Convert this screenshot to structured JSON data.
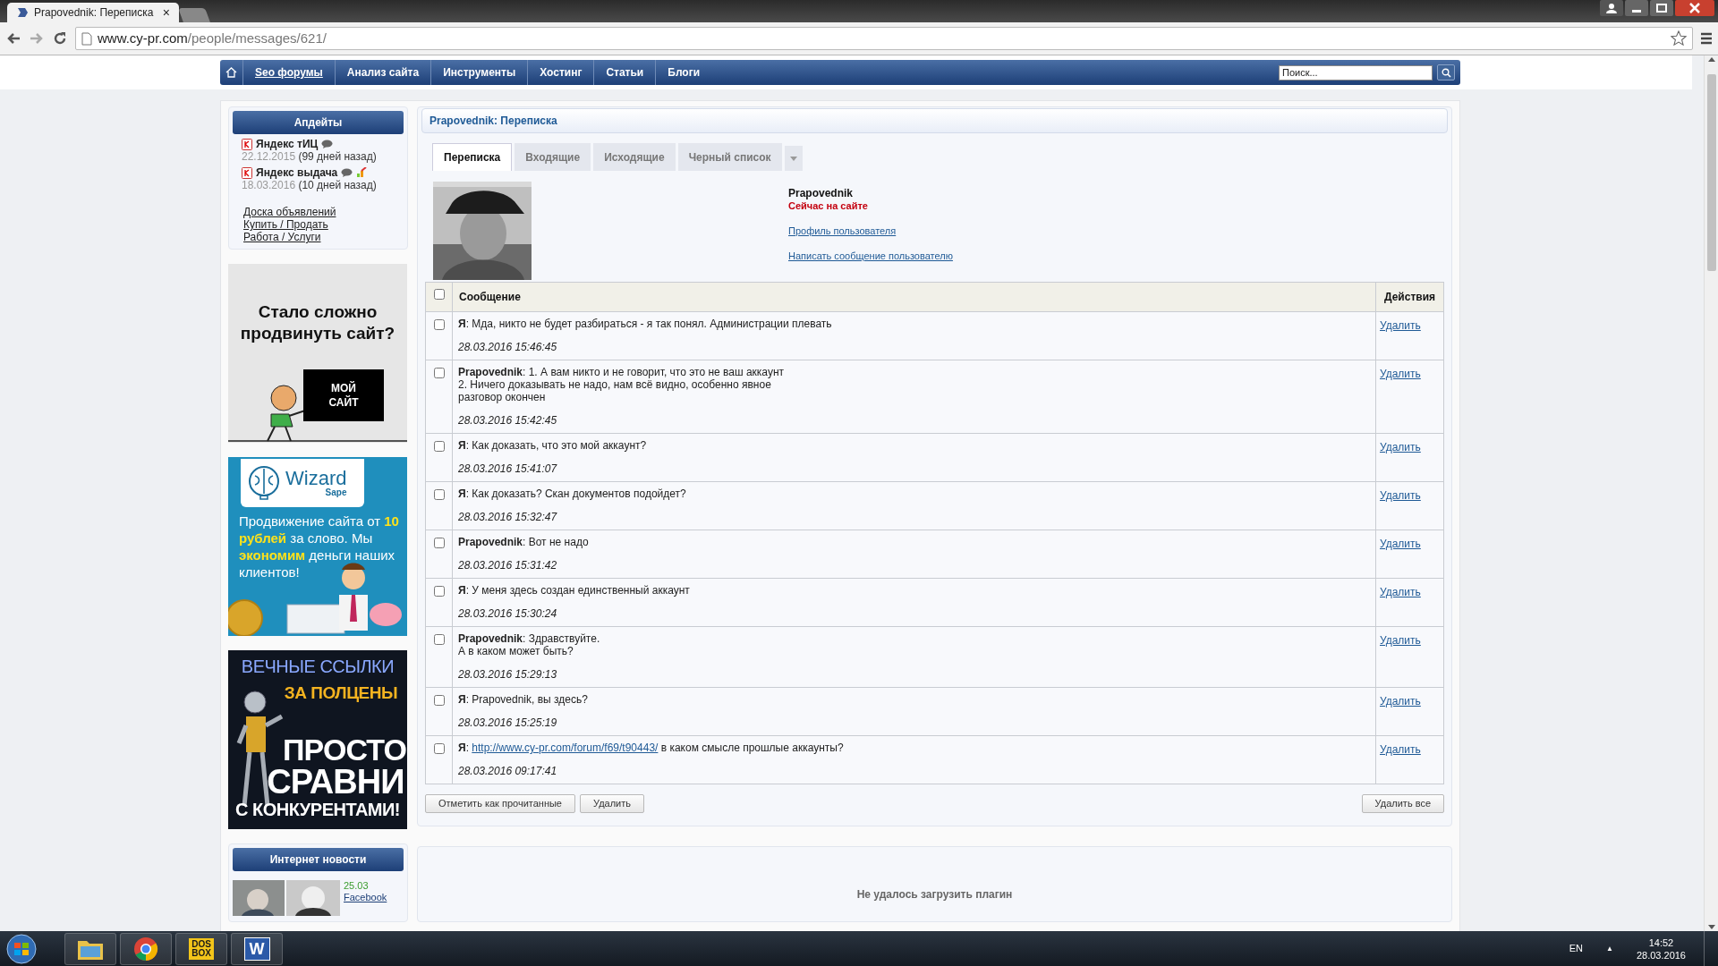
{
  "browser": {
    "tab_title": "Prapovednik: Переписка",
    "close": "×",
    "url_host": "www.cy-pr.com",
    "url_path": "/people/messages/621/"
  },
  "nav": {
    "items": [
      {
        "label": "Seo форумы",
        "selected": true
      },
      {
        "label": "Анализ сайта",
        "selected": false
      },
      {
        "label": "Инструменты",
        "selected": false
      },
      {
        "label": "Хостинг",
        "selected": false
      },
      {
        "label": "Статьи",
        "selected": false
      },
      {
        "label": "Блоги",
        "selected": false
      }
    ],
    "search": {
      "placeholder": "Поиск..."
    }
  },
  "sidebar": {
    "updates_title": "Апдейты",
    "updates": [
      {
        "name": "Яндекс тИЦ",
        "date": "22.12.2015",
        "ago": "(99 дней назад)",
        "rising": false
      },
      {
        "name": "Яндекс выдача",
        "date": "18.03.2016",
        "ago": "(10 дней назад)",
        "rising": true
      }
    ],
    "links": [
      "Доска объявлений",
      "Купить / Продать",
      "Работа / Услуги"
    ],
    "ads": [
      {
        "kind": "comic",
        "headline": "Стало сложно продвинуть сайт?",
        "sign": "МОЙ\nСАЙТ"
      },
      {
        "kind": "wizard",
        "brand": "Wizard",
        "sub": "Sape",
        "text": "Продвижение сайта от **10 рублей** за слово. Мы **экономим** деньги наших клиентов!"
      },
      {
        "kind": "robot",
        "lines": [
          "ВЕЧНЫЕ ССЫЛКИ",
          "ЗА ПОЛЦЕНЫ",
          "ПРОСТО",
          "СРАВНИ",
          "С КОНКУРЕНТАМИ!"
        ]
      }
    ],
    "news_title": "Интернет новости",
    "news": {
      "date": "25.03",
      "link": "Facebook"
    }
  },
  "main": {
    "title": "Prapovednik: Переписка",
    "tabs": [
      {
        "label": "Переписка",
        "selected": true
      },
      {
        "label": "Входящие",
        "selected": false
      },
      {
        "label": "Исходящие",
        "selected": false
      },
      {
        "label": "Черный список",
        "selected": false
      }
    ],
    "user": {
      "name": "Prapovednik",
      "status": "Сейчас на сайте",
      "links": [
        "Профиль пользователя",
        "Написать сообщение пользователю"
      ]
    },
    "table": {
      "columns": [
        "Сообщение",
        "Действия"
      ],
      "all_checked": false,
      "rows": [
        {
          "checked": false,
          "message": [
            {
              "kind": "text",
              "text": "**Я**: Мда, никто не будет разбираться - я так понял. Администрации плевать"
            }
          ],
          "time": "28.03.2016 15:46:45",
          "action": "Удалить"
        },
        {
          "checked": false,
          "message": [
            {
              "kind": "text",
              "text": "**Prapovednik**: 1. А вам никто и не говорит, что это не ваш аккаунт\n2. Ничего доказывать не надо, нам всё видно, особенно явное\nразговор окончен"
            }
          ],
          "time": "28.03.2016 15:42:45",
          "action": "Удалить"
        },
        {
          "checked": false,
          "message": [
            {
              "kind": "text",
              "text": "**Я**: Как доказать, что это мой аккаунт?"
            }
          ],
          "time": "28.03.2016 15:41:07",
          "action": "Удалить"
        },
        {
          "checked": false,
          "message": [
            {
              "kind": "text",
              "text": "**Я**: Как доказать? Скан документов подойдет?"
            }
          ],
          "time": "28.03.2016 15:32:47",
          "action": "Удалить"
        },
        {
          "checked": false,
          "message": [
            {
              "kind": "text",
              "text": "**Prapovednik**: Вот не надо"
            }
          ],
          "time": "28.03.2016 15:31:42",
          "action": "Удалить"
        },
        {
          "checked": false,
          "message": [
            {
              "kind": "text",
              "text": "**Я**: У меня здесь создан единственный аккаунт"
            }
          ],
          "time": "28.03.2016 15:30:24",
          "action": "Удалить"
        },
        {
          "checked": false,
          "message": [
            {
              "kind": "text",
              "text": "**Prapovednik**: Здравствуйте.\nА в каком может быть?"
            }
          ],
          "time": "28.03.2016 15:29:13",
          "action": "Удалить"
        },
        {
          "checked": false,
          "message": [
            {
              "kind": "text",
              "text": "**Я**: Prapovednik, вы здесь?"
            }
          ],
          "time": "28.03.2016 15:25:19",
          "action": "Удалить"
        },
        {
          "checked": false,
          "message": [
            {
              "kind": "text",
              "text": "**Я**: "
            },
            {
              "kind": "link",
              "text": "http://www.cy-pr.com/forum/f69/t90443/"
            },
            {
              "kind": "text",
              "text": " в каком смысле прошлые аккаунты?"
            }
          ],
          "time": "28.03.2016 09:17:41",
          "action": "Удалить"
        }
      ]
    },
    "buttons": [
      "Отметить как прочитанные",
      "Удалить"
    ],
    "delete_all": "Удалить все",
    "plugin_message": "Не удалось загрузить плагин"
  },
  "taskbar": {
    "apps": [
      {
        "kind": "folder"
      },
      {
        "kind": "chrome"
      },
      {
        "kind": "dosbox",
        "label": "DOS\nBOX"
      },
      {
        "kind": "word",
        "label": "W"
      }
    ],
    "language": "EN",
    "tray_arrow": "▲",
    "time": "14:52",
    "date": "28.03.2016"
  }
}
